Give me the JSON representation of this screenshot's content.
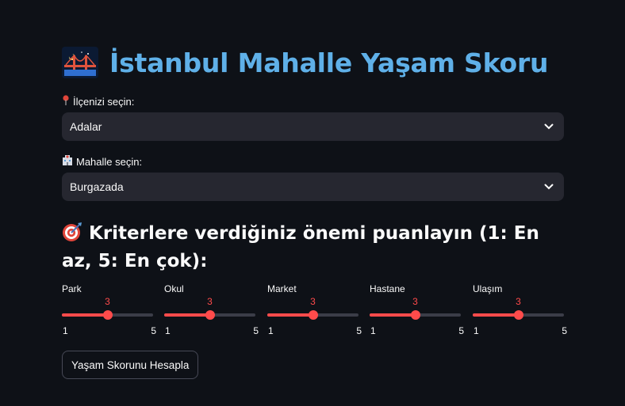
{
  "header": {
    "title": "İstanbul Mahalle Yaşam Skoru",
    "icon": "bridge-at-night-icon"
  },
  "district": {
    "icon": "pin-icon",
    "label": "İlçenizi seçin:",
    "selected": "Adalar"
  },
  "neighborhood": {
    "icon": "hospital-building-icon",
    "label": "Mahalle seçin:",
    "selected": "Burgazada"
  },
  "criteria": {
    "icon": "target-icon",
    "heading": "Kriterlere verdiğiniz önemi puanlayın (1: En az, 5: En çok):",
    "sliders": [
      {
        "label": "Park",
        "value": 3,
        "min": 1,
        "max": 5
      },
      {
        "label": "Okul",
        "value": 3,
        "min": 1,
        "max": 5
      },
      {
        "label": "Market",
        "value": 3,
        "min": 1,
        "max": 5
      },
      {
        "label": "Hastane",
        "value": 3,
        "min": 1,
        "max": 5
      },
      {
        "label": "Ulaşım",
        "value": 3,
        "min": 1,
        "max": 5
      }
    ]
  },
  "action": {
    "button_label": "Yaşam Skorunu Hesapla"
  },
  "colors": {
    "background": "#0e1117",
    "title": "#5fb0e8",
    "accent": "#ff4b4b",
    "select_bg": "#262730"
  }
}
